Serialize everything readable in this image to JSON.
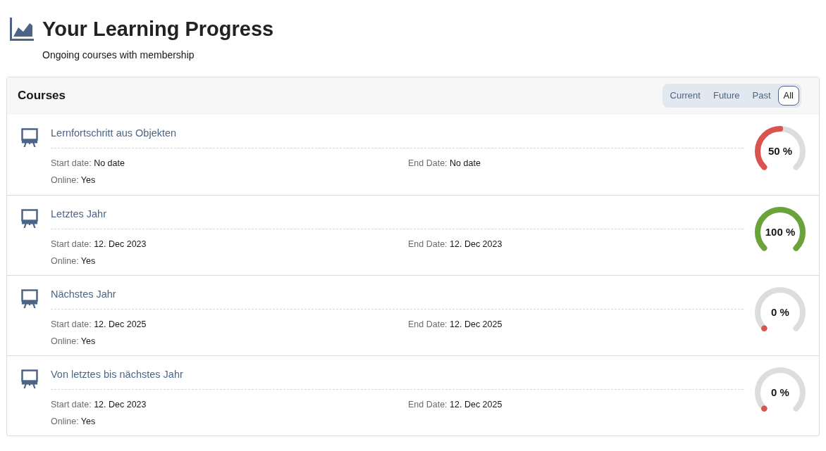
{
  "header": {
    "title": "Your Learning Progress",
    "subtitle": "Ongoing courses with membership"
  },
  "panel": {
    "title": "Courses",
    "filters": [
      {
        "label": "Current",
        "selected": false
      },
      {
        "label": "Future",
        "selected": false
      },
      {
        "label": "Past",
        "selected": false
      },
      {
        "label": "All",
        "selected": true
      }
    ]
  },
  "courses": [
    {
      "title": "Lernfortschritt aus Objekten",
      "start_label": "Start date:",
      "start": "No date",
      "end_label": "End Date:",
      "end": "No date",
      "online_label": "Online:",
      "online": "Yes",
      "reading": "50 %"
    },
    {
      "title": "Letztes Jahr",
      "start_label": "Start date:",
      "start": "12. Dec 2023",
      "end_label": "End Date:",
      "end": "12. Dec 2023",
      "online_label": "Online:",
      "online": "Yes",
      "reading": "100 %"
    },
    {
      "title": "Nächstes Jahr",
      "start_label": "Start date:",
      "start": "12. Dec 2025",
      "end_label": "End Date:",
      "end": "12. Dec 2025",
      "online_label": "Online:",
      "online": "Yes",
      "reading": "0 %"
    },
    {
      "title": "Von letztes bis nächstes Jahr",
      "start_label": "Start date:",
      "start": "12. Dec 2023",
      "end_label": "End Date:",
      "end": "12. Dec 2025",
      "online_label": "Online:",
      "online": "Yes",
      "reading": "0 %"
    }
  ]
}
